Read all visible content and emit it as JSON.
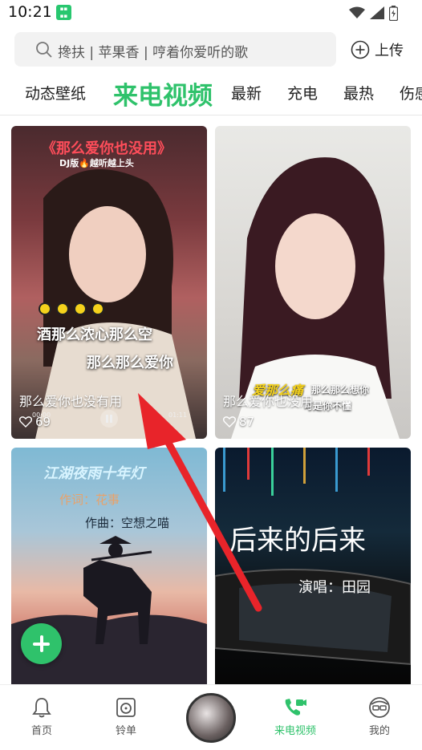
{
  "status": {
    "time": "10:21"
  },
  "search": {
    "placeholder": "搀扶 | 苹果香 | 哼着你爱听的歌",
    "upload_label": "上传"
  },
  "tabs": [
    {
      "label": "动态壁纸"
    },
    {
      "label": "来电视频",
      "active": true
    },
    {
      "label": "最新"
    },
    {
      "label": "充电"
    },
    {
      "label": "最热"
    },
    {
      "label": "伤感"
    }
  ],
  "cards": [
    {
      "title": "那么爱你也没有用",
      "likes": "69",
      "overlay": [
        "《那么爱你也没用》",
        "DJ版🔥越听越上头",
        "酒那么浓心那么空",
        "那么那么爱你",
        "00:00",
        "01:11"
      ]
    },
    {
      "title": "那么爱你也没用",
      "likes": "87",
      "overlay": [
        "爱那么痛",
        "那么那么想你",
        "可是你不懂"
      ]
    },
    {
      "overlay": [
        "江湖夜雨十年灯",
        "作词：花事",
        "作曲：空想之喵"
      ]
    },
    {
      "overlay": [
        "后来的后来",
        "演唱：田园"
      ]
    }
  ],
  "bottom_nav": [
    {
      "label": "首页",
      "icon": "bell-icon"
    },
    {
      "label": "铃单",
      "icon": "speaker-icon"
    },
    {
      "label": "",
      "icon": "avatar-disc"
    },
    {
      "label": "来电视频",
      "icon": "video-call-icon",
      "active": true
    },
    {
      "label": "我的",
      "icon": "profile-icon"
    }
  ],
  "colors": {
    "accent": "#2fc26b",
    "arrow": "#e8242a"
  }
}
